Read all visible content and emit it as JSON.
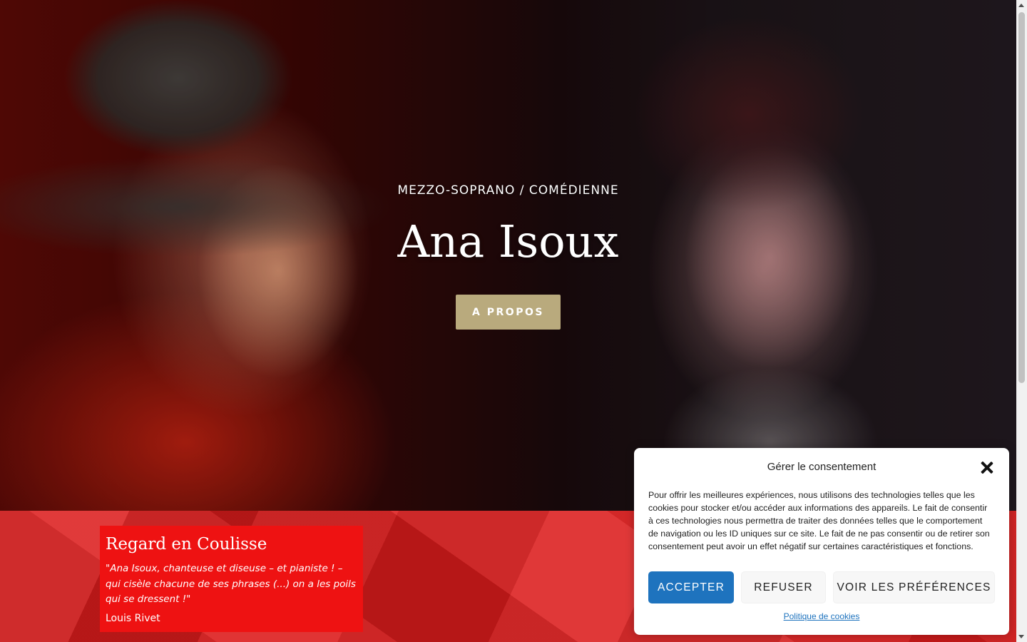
{
  "hero": {
    "subtitle": "MEZZO-SOPRANO / COMÉDIENNE",
    "title": "Ana Isoux",
    "button_label": "A PROPOS"
  },
  "quote": {
    "title": "Regard en Coulisse",
    "text": "\"Ana Isoux, chanteuse et diseuse – et pianiste ! – qui cisèle chacune de ses phrases (...) on a les poils qui se dressent !\"",
    "author": "Louis Rivet"
  },
  "consent": {
    "title": "Gérer le consentement",
    "body": "Pour offrir les meilleures expériences, nous utilisons des technologies telles que les cookies pour stocker et/ou accéder aux informations des appareils. Le fait de consentir à ces technologies nous permettra de traiter des données telles que le comportement de navigation ou les ID uniques sur ce site. Le fait de ne pas consentir ou de retirer son consentement peut avoir un effet négatif sur certaines caractéristiques et fonctions.",
    "accept_label": "ACCEPTER",
    "refuse_label": "REFUSER",
    "preferences_label": "VOIR LES PRÉFÉRENCES",
    "policy_link": "Politique de cookies",
    "close_icon": "close-icon"
  },
  "colors": {
    "accent_gold": "#b9aa7d",
    "band_red": "#dc1c1c",
    "accept_blue": "#1e73be"
  }
}
